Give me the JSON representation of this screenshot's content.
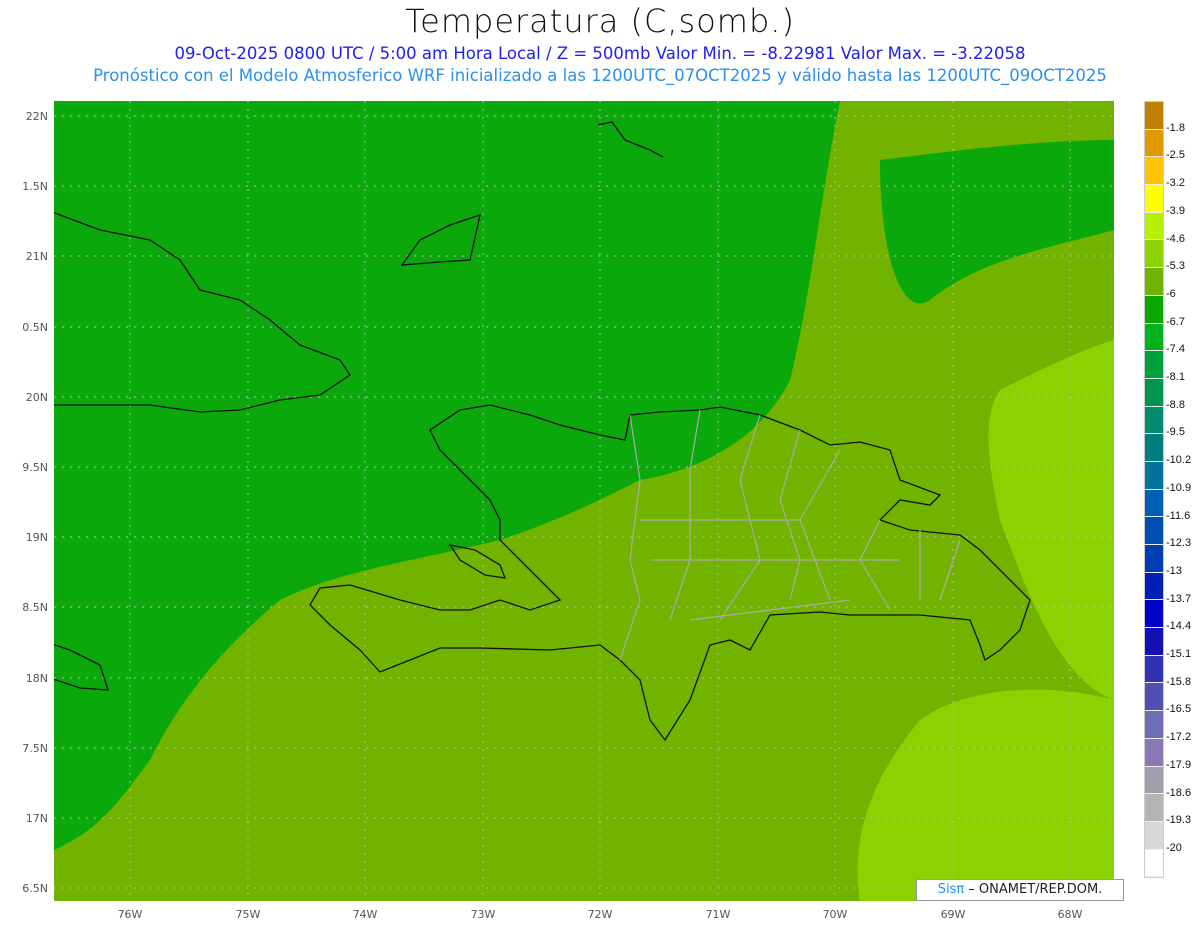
{
  "title": "Temperatura (C,somb.)",
  "subtitle1": "09-Oct-2025  0800 UTC / 5:00 am Hora Local / Z = 500mb  Valor Min. = -8.22981  Valor Max. = -3.22058",
  "subtitle2": "Pronóstico con el Modelo Atmosferico WRF inicializado a las 1200UTC_07OCT2025 y válido hasta las  1200UTC_09OCT2025",
  "lat_labels": [
    "22N",
    "1.5N",
    "21N",
    "0.5N",
    "20N",
    "9.5N",
    "19N",
    "8.5N",
    "18N",
    "7.5N",
    "17N",
    "6.5N"
  ],
  "lon_labels": [
    "76W",
    "75W",
    "74W",
    "73W",
    "72W",
    "71W",
    "70W",
    "69W",
    "68W"
  ],
  "logo": {
    "brand": "Sisπ",
    "text": " – ONAMET/REP.DOM."
  },
  "colorbar": {
    "labels": [
      "-1.8",
      "-2.5",
      "-3.2",
      "-3.9",
      "-4.6",
      "-5.3",
      "-6",
      "-6.7",
      "-7.4",
      "-8.1",
      "-8.8",
      "-9.5",
      "-10.2",
      "-10.9",
      "-11.6",
      "-12.3",
      "-13",
      "-13.7",
      "-14.4",
      "-15.1",
      "-15.8",
      "-16.5",
      "-17.2",
      "-17.9",
      "-18.6",
      "-19.3",
      "-20"
    ],
    "colors": [
      "#c08000",
      "#e09a00",
      "#ffc400",
      "#ffff00",
      "#b4f000",
      "#8cd200",
      "#6eb400",
      "#0aa800",
      "#00b21e",
      "#00a03c",
      "#009650",
      "#008c6e",
      "#007e7e",
      "#00749a",
      "#005eb4",
      "#0050b4",
      "#003cb4",
      "#0020b4",
      "#0000c8",
      "#1410b4",
      "#3232b4",
      "#5050b4",
      "#6e6eb4",
      "#8c78b4",
      "#a0a0aa",
      "#b4b4b4",
      "#d7d7d7",
      "#ffffff"
    ]
  }
}
